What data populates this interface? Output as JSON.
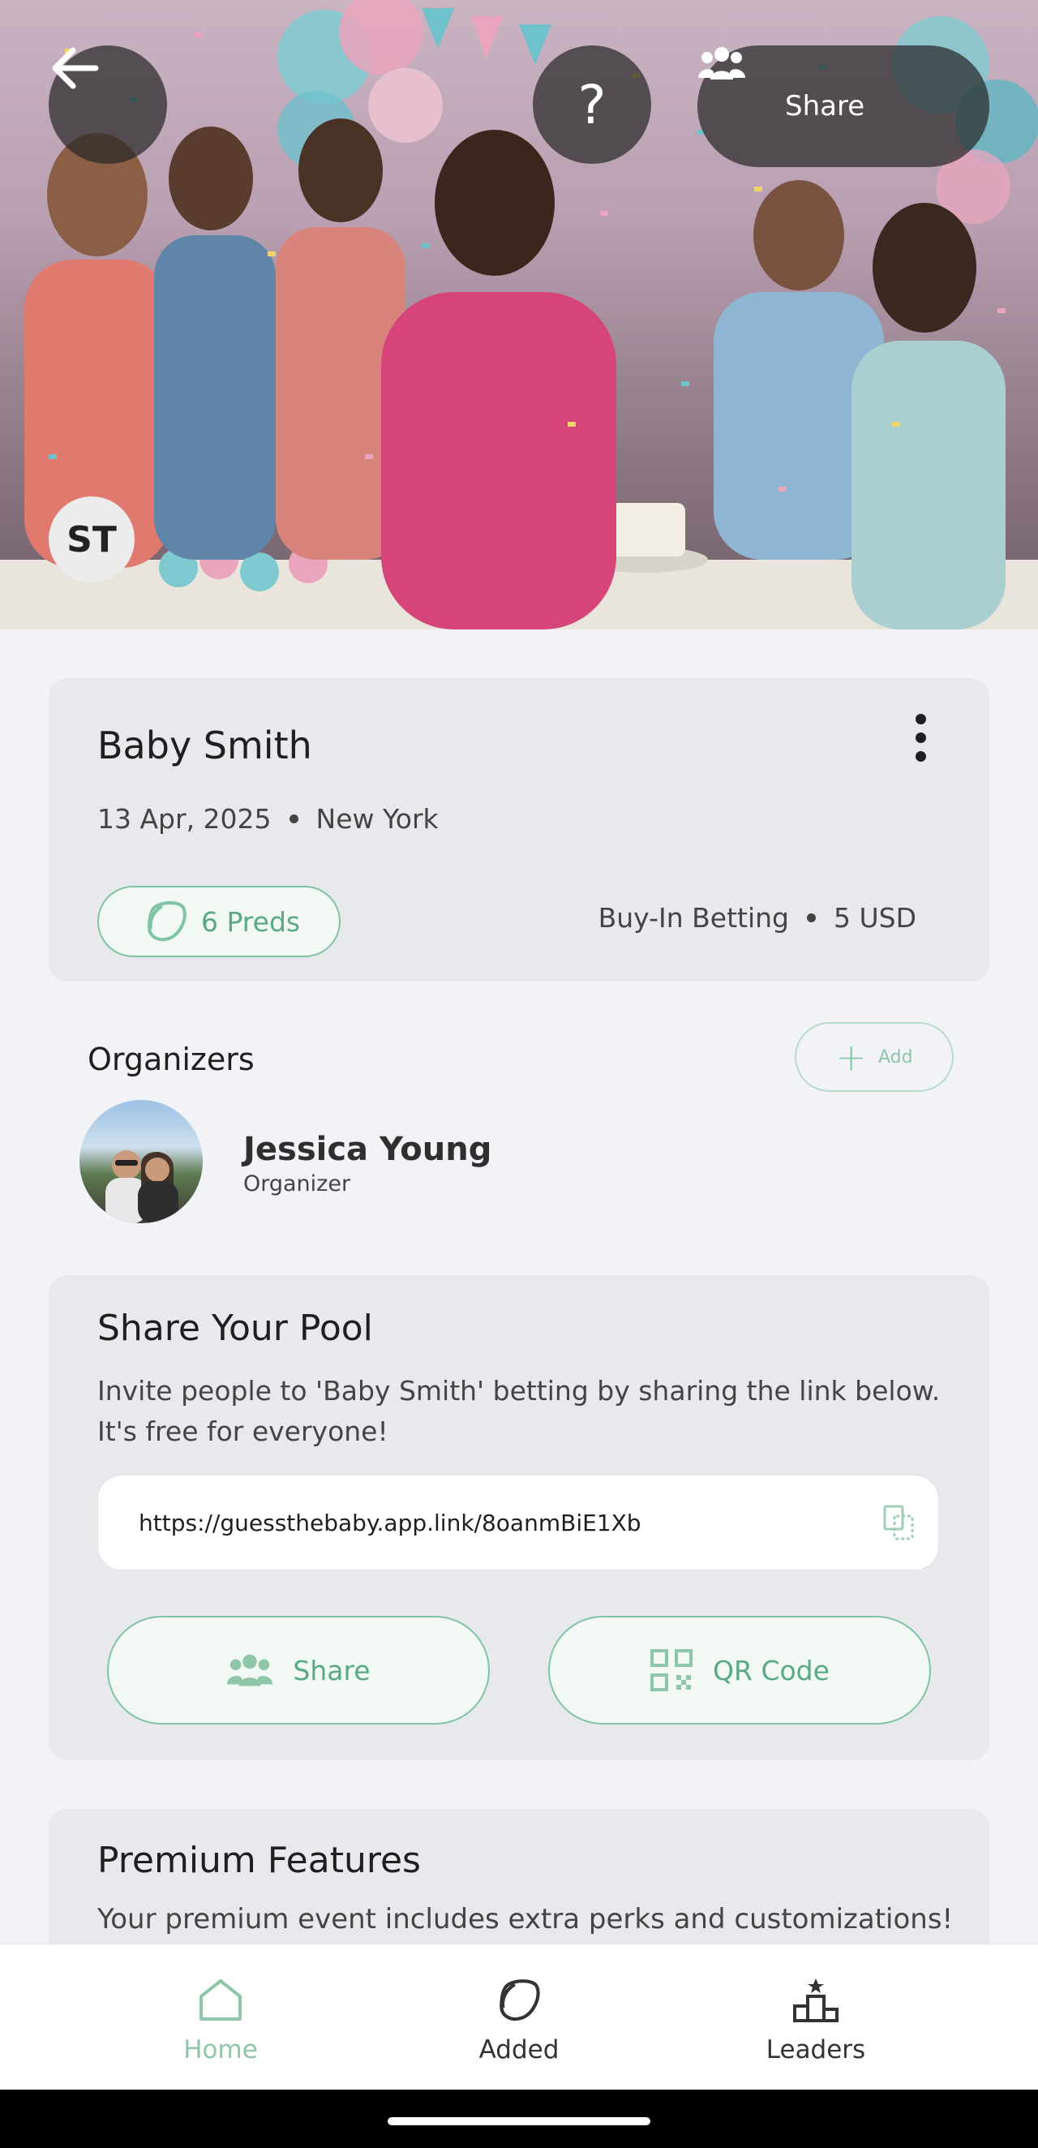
{
  "hero": {
    "avatar_initials": "ST",
    "help_glyph": "?",
    "share_label": "Share",
    "icons": [
      "back-arrow-icon",
      "help-icon",
      "group-icon"
    ]
  },
  "event": {
    "title": "Baby Smith",
    "date": "13 Apr, 2025",
    "location": "New York",
    "preds": "6 Preds",
    "betting_type": "Buy-In Betting",
    "amount": "5 USD"
  },
  "organizers": {
    "title": "Organizers",
    "add_label": "Add",
    "items": [
      {
        "name": "Jessica Young",
        "role": "Organizer"
      }
    ]
  },
  "share_pool": {
    "title": "Share Your Pool",
    "description": "Invite people to 'Baby Smith' betting by sharing the link below. It's free for everyone!",
    "link": "https://guessthebaby.app.link/8oanmBiE1Xb",
    "share_label": "Share",
    "qr_label": "QR Code"
  },
  "premium": {
    "title": "Premium Features",
    "description": "Your premium event includes extra perks and customizations!"
  },
  "nav": {
    "home": "Home",
    "added": "Added",
    "leaders": "Leaders",
    "active": "Home"
  },
  "colors": {
    "accent": "#7fc4a4",
    "accent_text": "#5aa985",
    "background": "#f1f3f7",
    "card": "#e8e9ed"
  }
}
